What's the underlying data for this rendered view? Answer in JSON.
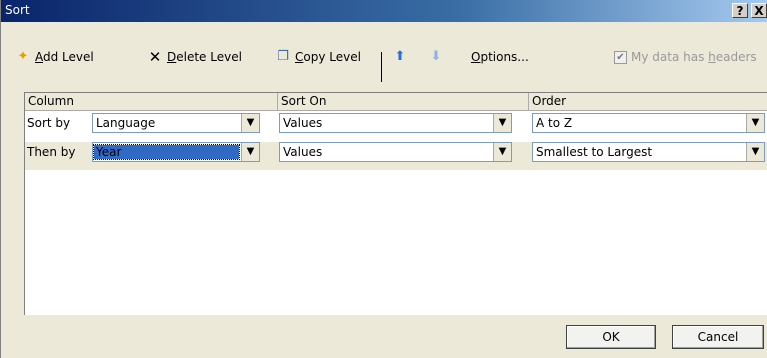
{
  "window": {
    "title": "Sort",
    "help_label": "?",
    "close_label": "X"
  },
  "toolbar": {
    "add_level": {
      "icon": "add-level-icon",
      "prefix": "",
      "mnemonic": "A",
      "rest": "dd Level"
    },
    "delete_level": {
      "icon": "delete-icon",
      "prefix": "",
      "mnemonic": "D",
      "rest": "elete Level"
    },
    "copy_level": {
      "icon": "copy-icon",
      "prefix": "",
      "mnemonic": "C",
      "rest": "opy Level"
    },
    "move_up_icon": "up-arrow-icon",
    "move_down_icon": "down-arrow-icon",
    "options": {
      "mnemonic": "O",
      "rest": "ptions..."
    },
    "headers_checkbox": {
      "checked": true,
      "prefix": "My data has ",
      "mnemonic": "h",
      "rest": "eaders"
    }
  },
  "columns": {
    "column": "Column",
    "sort_on": "Sort On",
    "order": "Order"
  },
  "rows": [
    {
      "label": "Sort by",
      "column": "Language",
      "sort_on": "Values",
      "order": "A to Z",
      "selected": false
    },
    {
      "label": "Then by",
      "column": "Year",
      "sort_on": "Values",
      "order": "Smallest to Largest",
      "selected": true
    }
  ],
  "buttons": {
    "ok": "OK",
    "cancel": "Cancel"
  },
  "colors": {
    "title_start": "#0a246a",
    "selection": "#3169c6",
    "dialog_bg": "#ece9d8"
  }
}
